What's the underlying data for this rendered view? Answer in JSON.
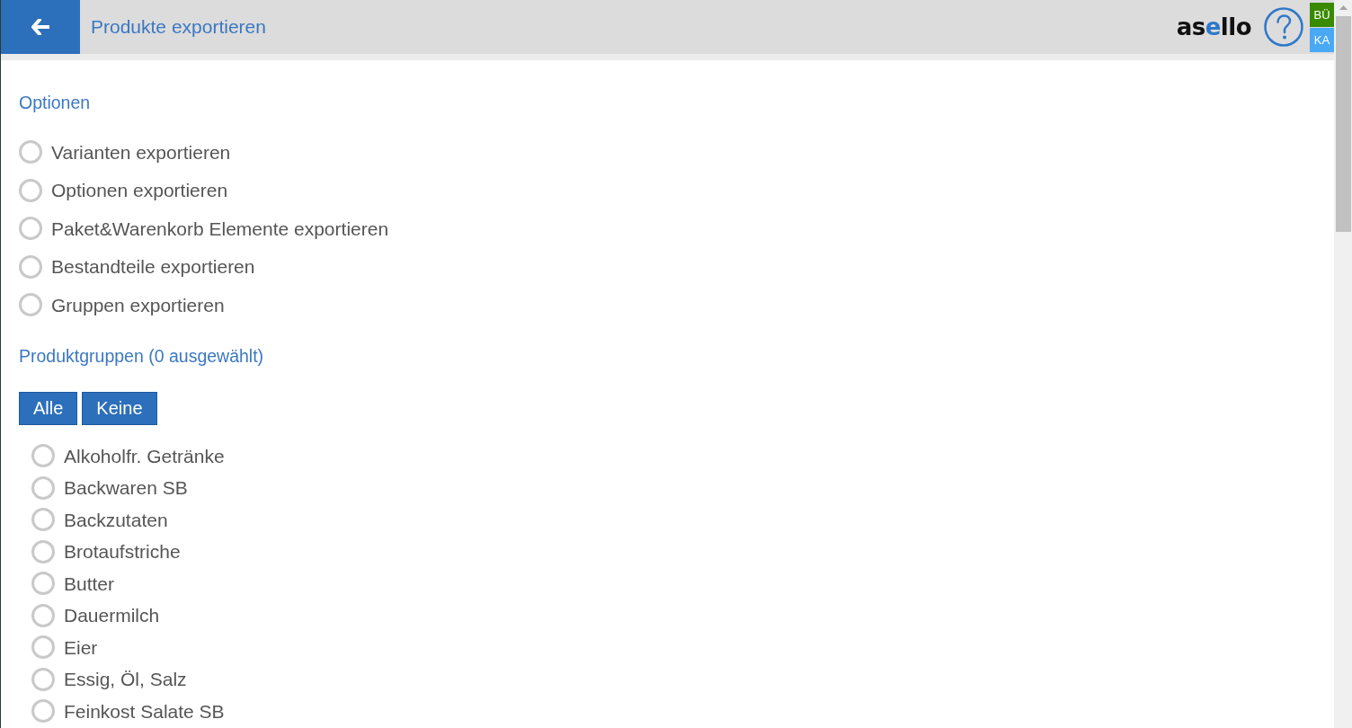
{
  "header": {
    "title": "Produkte exportieren",
    "logo": [
      {
        "text": "as",
        "highlight": false
      },
      {
        "text": "e",
        "highlight": true
      },
      {
        "text": "llo",
        "highlight": false
      }
    ],
    "user_badges": [
      {
        "label": "BÜ",
        "color": "#3a8a00"
      },
      {
        "label": "KA",
        "color": "#4aa9f5"
      }
    ]
  },
  "options": {
    "heading": "Optionen",
    "items": [
      {
        "label": "Varianten exportieren",
        "checked": false
      },
      {
        "label": "Optionen exportieren",
        "checked": false
      },
      {
        "label": "Paket&Warenkorb Elemente exportieren",
        "checked": false
      },
      {
        "label": "Bestandteile exportieren",
        "checked": false
      },
      {
        "label": "Gruppen exportieren",
        "checked": false
      }
    ]
  },
  "product_groups": {
    "heading": "Produktgruppen (0 ausgewählt)",
    "buttons": [
      "Alle",
      "Keine"
    ],
    "items": [
      {
        "label": "Alkoholfr. Getränke",
        "checked": false
      },
      {
        "label": "Backwaren SB",
        "checked": false
      },
      {
        "label": "Backzutaten",
        "checked": false
      },
      {
        "label": "Brotaufstriche",
        "checked": false
      },
      {
        "label": "Butter",
        "checked": false
      },
      {
        "label": "Dauermilch",
        "checked": false
      },
      {
        "label": "Eier",
        "checked": false
      },
      {
        "label": "Essig, Öl, Salz",
        "checked": false
      },
      {
        "label": "Feinkost Salate SB",
        "checked": false
      }
    ]
  }
}
